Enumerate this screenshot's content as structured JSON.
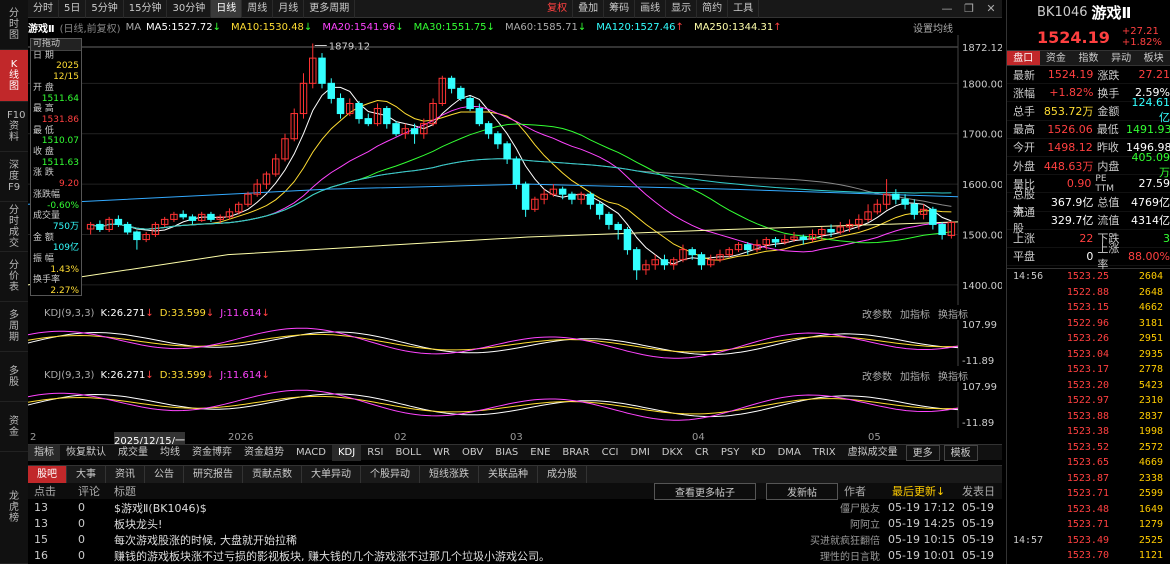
{
  "left_nav": [
    {
      "label": "分时图",
      "active": false
    },
    {
      "label": "K线图",
      "active": true
    },
    {
      "label": "F10资料",
      "active": false
    },
    {
      "label": "深度F9",
      "active": false
    },
    {
      "label": "分时成交",
      "active": false
    },
    {
      "label": "分价表",
      "active": false
    },
    {
      "label": "多周期",
      "active": false
    },
    {
      "label": "多股",
      "active": false
    },
    {
      "label": "资金",
      "active": false
    },
    {
      "label": "龙虎榜",
      "active": false
    }
  ],
  "toolbar": {
    "periods": [
      "分时",
      "5日",
      "5分钟",
      "15分钟",
      "30分钟",
      "日线",
      "周线",
      "月线",
      "更多周期"
    ],
    "active_period": "日线",
    "tools": [
      "复权",
      "叠加",
      "筹码",
      "画线",
      "显示",
      "简约",
      "工具"
    ]
  },
  "ma": {
    "name": "游戏Ⅱ",
    "sub": "(日线,前复权)",
    "items": [
      {
        "label": "MA",
        "value": "",
        "color": "#aaaaaa"
      },
      {
        "label": "MA5:",
        "value": "1527.72",
        "arrow": "↓",
        "color": "#ffffff"
      },
      {
        "label": "MA10:",
        "value": "1530.48",
        "arrow": "↓",
        "color": "#ffdd33"
      },
      {
        "label": "MA20:",
        "value": "1541.96",
        "arrow": "↓",
        "color": "#ff44ff"
      },
      {
        "label": "MA30:",
        "value": "1551.75",
        "arrow": "↓",
        "color": "#33ff33"
      },
      {
        "label": "MA60:",
        "value": "1585.71",
        "arrow": "↓",
        "color": "#aaaaaa"
      },
      {
        "label": "MA120:",
        "value": "1527.46",
        "arrow": "↑",
        "color": "#33ffff"
      },
      {
        "label": "MA250:",
        "value": "1344.31",
        "arrow": "↑",
        "color": "#ffffaa"
      }
    ],
    "settings": "设置均线"
  },
  "kline": {
    "price_axis": [
      "1872.12",
      "1800.00",
      "1700.00",
      "1600.00",
      "1500.00",
      "1400.00"
    ],
    "max_label": "1879.12",
    "ylim": [
      1380,
      1880
    ]
  },
  "infobox": {
    "title": "可拖动",
    "rows": [
      {
        "label": "日 期",
        "value": ""
      },
      {
        "label": "",
        "value": "2025"
      },
      {
        "label": "",
        "value": "12/15"
      },
      {
        "label": "开 盘",
        "value": ""
      },
      {
        "label": "",
        "value": "1511.64"
      },
      {
        "label": "最 高",
        "value": ""
      },
      {
        "label": "",
        "value": "1531.86"
      },
      {
        "label": "最 低",
        "value": ""
      },
      {
        "label": "",
        "value": "1510.07"
      },
      {
        "label": "收 盘",
        "value": ""
      },
      {
        "label": "",
        "value": "1511.63"
      },
      {
        "label": "涨 跌",
        "value": ""
      },
      {
        "label": "",
        "value": "9.20"
      },
      {
        "label": "涨跌幅",
        "value": ""
      },
      {
        "label": "",
        "value": "-0.60%"
      },
      {
        "label": "成交量",
        "value": ""
      },
      {
        "label": "",
        "value": "750万"
      },
      {
        "label": "金 额",
        "value": ""
      },
      {
        "label": "",
        "value": "109亿"
      },
      {
        "label": "振 幅",
        "value": ""
      },
      {
        "label": "",
        "value": "1.43%"
      },
      {
        "label": "换手率",
        "value": ""
      },
      {
        "label": "",
        "value": "2.27%"
      }
    ]
  },
  "kdj1": {
    "name": "KDJ(9,3,3)",
    "k": "K:26.271",
    "d": "D:33.599",
    "j": "J:11.614",
    "actions": [
      "改参数",
      "加指标",
      "换指标"
    ],
    "axis": [
      "107.99",
      "-11.89"
    ]
  },
  "kdj2": {
    "name": "KDJ(9,3,3)",
    "k": "K:26.271",
    "d": "D:33.599",
    "j": "J:11.614",
    "actions": [
      "改参数",
      "加指标",
      "换指标"
    ],
    "axis": [
      "107.99",
      "-11.89"
    ]
  },
  "xaxis": {
    "labels": [
      "2",
      "2025/12/15/一",
      "2026",
      "02",
      "03",
      "04",
      "05"
    ]
  },
  "indicators": {
    "items": [
      "指标",
      "恢复默认",
      "成交量",
      "均线",
      "资金博弈",
      "资金趋势",
      "MACD",
      "KDJ",
      "RSI",
      "BOLL",
      "WR",
      "OBV",
      "BIAS",
      "ENE",
      "BRAR",
      "CCI",
      "DMI",
      "DKX",
      "CR",
      "PSY",
      "KD",
      "DMA",
      "TRIX",
      "虚拟成交量",
      "更多",
      "模板"
    ],
    "active": "KDJ"
  },
  "bottom_tabs": [
    "股吧",
    "大事",
    "资讯",
    "公告",
    "研究报告",
    "贡献点数",
    "大单异动",
    "个股异动",
    "短线涨跌",
    "关联品种",
    "成分股"
  ],
  "posts": {
    "headers": [
      "点击",
      "评论",
      "标题"
    ],
    "view_more": "查看更多帖子",
    "post_btn": "发新帖",
    "author": "作者",
    "last_update": "最后更新↓",
    "posted": "发表日",
    "rows": [
      {
        "clicks": "13",
        "comments": "0",
        "title": "$游戏Ⅱ(BK1046)$",
        "author": "僵尸股友",
        "updated": "05-19 17:12",
        "posted": "05-19"
      },
      {
        "clicks": "13",
        "comments": "0",
        "title": "板块龙头!",
        "author": "阿阿立",
        "updated": "05-19 14:25",
        "posted": "05-19"
      },
      {
        "clicks": "15",
        "comments": "0",
        "title": "每次游戏股涨的时候, 大盘就开始拉稀",
        "author": "买进就疯狂翻倍",
        "updated": "05-19 10:15",
        "posted": "05-19"
      },
      {
        "clicks": "16",
        "comments": "0",
        "title": "赚钱的游戏板块涨不过亏损的影视板块, 赚大钱的几个游戏涨不过那几个垃圾小游戏公司。",
        "author": "理性的日言耽",
        "updated": "05-19 10:01",
        "posted": "05-19"
      }
    ]
  },
  "right": {
    "code": "BK1046",
    "name": "游戏Ⅱ",
    "price": "1524.19",
    "change": "+27.21",
    "pct": "+1.82%",
    "tabs": [
      "盘口",
      "资金",
      "指数",
      "异动",
      "板块"
    ],
    "quotes": [
      [
        "最新",
        "1524.19",
        "涨跌",
        "27.21"
      ],
      [
        "涨幅",
        "+1.82%",
        "换手",
        "2.59%"
      ],
      [
        "总手",
        "853.72万",
        "金额",
        "124.61亿"
      ],
      [
        "最高",
        "1526.06",
        "最低",
        "1491.93"
      ],
      [
        "今开",
        "1498.12",
        "昨收",
        "1496.98"
      ],
      [
        "外盘",
        "448.63万",
        "内盘",
        "405.09万"
      ],
      [
        "量比",
        "0.90",
        "PE TTM",
        "27.59"
      ],
      [
        "总股本",
        "367.9亿",
        "总值",
        "4769亿"
      ],
      [
        "流通股",
        "329.7亿",
        "流值",
        "4314亿"
      ],
      [
        "上涨",
        "22",
        "下跌",
        "3"
      ],
      [
        "平盘",
        "0",
        "上涨率",
        "88.00%"
      ]
    ],
    "ticks": [
      [
        "14:56",
        "1523.25",
        "2604"
      ],
      [
        "",
        "1522.88",
        "2648"
      ],
      [
        "",
        "1523.15",
        "4662"
      ],
      [
        "",
        "1522.96",
        "3181"
      ],
      [
        "",
        "1523.26",
        "2951"
      ],
      [
        "",
        "1523.04",
        "2935"
      ],
      [
        "",
        "1523.17",
        "2778"
      ],
      [
        "",
        "1523.20",
        "5423"
      ],
      [
        "",
        "1522.97",
        "2310"
      ],
      [
        "",
        "1523.88",
        "2837"
      ],
      [
        "",
        "1523.38",
        "1998"
      ],
      [
        "",
        "1523.52",
        "2572"
      ],
      [
        "",
        "1523.65",
        "4669"
      ],
      [
        "",
        "1523.87",
        "2338"
      ],
      [
        "",
        "1523.71",
        "2599"
      ],
      [
        "",
        "1523.48",
        "1649"
      ],
      [
        "",
        "1523.71",
        "1279"
      ],
      [
        "14:57",
        "1523.49",
        "2525"
      ],
      [
        "",
        "1523.70",
        "1121"
      ]
    ]
  },
  "chart_data": {
    "type": "candlestick",
    "ylim": [
      1380,
      1880
    ],
    "x_months": [
      "2025-12",
      "2026-01",
      "2026-02",
      "2026-03",
      "2026-04",
      "2026-05"
    ],
    "candles": [
      [
        1511,
        1520,
        1500,
        1525
      ],
      [
        1520,
        1510,
        1505,
        1528
      ],
      [
        1510,
        1530,
        1505,
        1535
      ],
      [
        1530,
        1520,
        1515,
        1538
      ],
      [
        1520,
        1505,
        1500,
        1525
      ],
      [
        1505,
        1490,
        1470,
        1508
      ],
      [
        1490,
        1500,
        1485,
        1505
      ],
      [
        1500,
        1520,
        1495,
        1525
      ],
      [
        1520,
        1530,
        1515,
        1535
      ],
      [
        1530,
        1540,
        1525,
        1545
      ],
      [
        1540,
        1535,
        1530,
        1548
      ],
      [
        1535,
        1528,
        1520,
        1540
      ],
      [
        1528,
        1540,
        1525,
        1545
      ],
      [
        1540,
        1530,
        1525,
        1545
      ],
      [
        1530,
        1535,
        1522,
        1540
      ],
      [
        1535,
        1545,
        1530,
        1552
      ],
      [
        1545,
        1560,
        1540,
        1565
      ],
      [
        1560,
        1580,
        1555,
        1585
      ],
      [
        1580,
        1600,
        1575,
        1610
      ],
      [
        1600,
        1620,
        1590,
        1625
      ],
      [
        1620,
        1650,
        1615,
        1660
      ],
      [
        1650,
        1690,
        1645,
        1700
      ],
      [
        1690,
        1740,
        1685,
        1750
      ],
      [
        1740,
        1800,
        1730,
        1820
      ],
      [
        1800,
        1850,
        1790,
        1879
      ],
      [
        1850,
        1800,
        1790,
        1860
      ],
      [
        1800,
        1770,
        1760,
        1810
      ],
      [
        1770,
        1740,
        1730,
        1780
      ],
      [
        1740,
        1760,
        1735,
        1770
      ],
      [
        1760,
        1730,
        1720,
        1765
      ],
      [
        1730,
        1720,
        1715,
        1740
      ],
      [
        1720,
        1750,
        1715,
        1760
      ],
      [
        1750,
        1720,
        1710,
        1755
      ],
      [
        1720,
        1700,
        1695,
        1725
      ],
      [
        1700,
        1710,
        1690,
        1720
      ],
      [
        1710,
        1700,
        1680,
        1720
      ],
      [
        1700,
        1720,
        1690,
        1730
      ],
      [
        1720,
        1760,
        1715,
        1770
      ],
      [
        1760,
        1810,
        1755,
        1815
      ],
      [
        1810,
        1790,
        1780,
        1815
      ],
      [
        1790,
        1770,
        1765,
        1795
      ],
      [
        1770,
        1750,
        1745,
        1775
      ],
      [
        1750,
        1720,
        1715,
        1760
      ],
      [
        1720,
        1700,
        1690,
        1725
      ],
      [
        1700,
        1680,
        1670,
        1705
      ],
      [
        1680,
        1650,
        1640,
        1685
      ],
      [
        1650,
        1600,
        1590,
        1655
      ],
      [
        1600,
        1550,
        1535,
        1605
      ],
      [
        1550,
        1570,
        1545,
        1575
      ],
      [
        1570,
        1580,
        1560,
        1590
      ],
      [
        1580,
        1590,
        1575,
        1600
      ],
      [
        1590,
        1580,
        1570,
        1595
      ],
      [
        1580,
        1570,
        1560,
        1585
      ],
      [
        1570,
        1580,
        1560,
        1585
      ],
      [
        1580,
        1560,
        1550,
        1585
      ],
      [
        1560,
        1540,
        1530,
        1565
      ],
      [
        1540,
        1520,
        1510,
        1545
      ],
      [
        1520,
        1510,
        1490,
        1525
      ],
      [
        1510,
        1470,
        1460,
        1515
      ],
      [
        1470,
        1430,
        1410,
        1475
      ],
      [
        1430,
        1440,
        1420,
        1450
      ],
      [
        1440,
        1450,
        1430,
        1460
      ],
      [
        1450,
        1440,
        1430,
        1460
      ],
      [
        1440,
        1450,
        1430,
        1455
      ],
      [
        1450,
        1470,
        1445,
        1480
      ],
      [
        1470,
        1460,
        1450,
        1475
      ],
      [
        1460,
        1440,
        1430,
        1465
      ],
      [
        1440,
        1450,
        1435,
        1460
      ],
      [
        1450,
        1460,
        1445,
        1470
      ],
      [
        1460,
        1470,
        1455,
        1475
      ],
      [
        1470,
        1480,
        1465,
        1485
      ],
      [
        1480,
        1470,
        1460,
        1485
      ],
      [
        1470,
        1480,
        1465,
        1490
      ],
      [
        1480,
        1490,
        1470,
        1495
      ],
      [
        1490,
        1485,
        1475,
        1495
      ],
      [
        1485,
        1490,
        1480,
        1500
      ],
      [
        1490,
        1495,
        1485,
        1505
      ],
      [
        1495,
        1490,
        1480,
        1500
      ],
      [
        1490,
        1500,
        1485,
        1510
      ],
      [
        1500,
        1510,
        1490,
        1515
      ],
      [
        1510,
        1505,
        1495,
        1520
      ],
      [
        1505,
        1515,
        1500,
        1525
      ],
      [
        1515,
        1520,
        1505,
        1530
      ],
      [
        1520,
        1530,
        1510,
        1540
      ],
      [
        1530,
        1545,
        1525,
        1560
      ],
      [
        1545,
        1560,
        1540,
        1570
      ],
      [
        1560,
        1580,
        1550,
        1610
      ],
      [
        1580,
        1570,
        1560,
        1590
      ],
      [
        1570,
        1560,
        1550,
        1580
      ],
      [
        1560,
        1540,
        1530,
        1570
      ],
      [
        1540,
        1550,
        1530,
        1560
      ],
      [
        1550,
        1520,
        1510,
        1555
      ],
      [
        1520,
        1500,
        1490,
        1525
      ],
      [
        1498,
        1524,
        1492,
        1526
      ]
    ]
  }
}
